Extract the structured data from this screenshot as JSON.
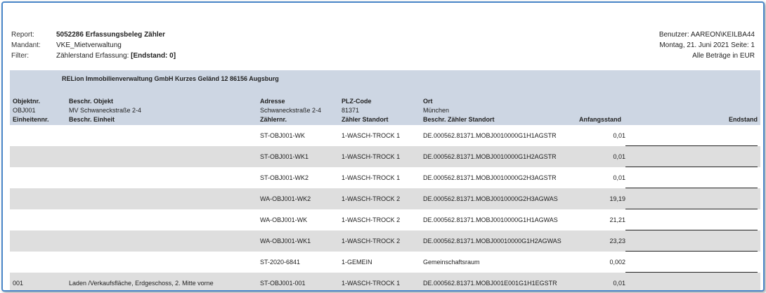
{
  "header": {
    "report_label": "Report:",
    "report_value": "5052286 Erfassungsbeleg Zähler",
    "mandant_label": "Mandant:",
    "mandant_value": "VKE_Mietverwaltung",
    "filter_label": "Filter:",
    "filter_prefix": "Zählerstand Erfassung: ",
    "filter_value": "[Endstand: 0]",
    "user": "Benutzer: AAREON\\KEILBA44",
    "date_page": "Montag, 21. Juni 2021 Seite: 1",
    "currency_note": "Alle Beträge in EUR"
  },
  "company": "RELion Immobilienverwaltung GmbH Kurzes Geländ 12 86156 Augsburg",
  "object_headers": {
    "objektnr": "Objektnr.",
    "beschr_objekt": "Beschr. Objekt",
    "adresse": "Adresse",
    "plz": "PLZ-Code",
    "ort": "Ort"
  },
  "object": {
    "objektnr": "OBJ001",
    "beschr_objekt": "MV Schwaneckstraße 2-4",
    "adresse": "Schwaneckstraße 2-4",
    "plz": "81371",
    "ort": "München"
  },
  "columns": {
    "einheitennr": "Einheitennr.",
    "beschr_einheit": "Beschr. Einheit",
    "zaehlernr": "Zählernr.",
    "zaehler_standort": "Zähler Standort",
    "beschr_zaehler_standort": "Beschr. Zähler Standort",
    "anfangsstand": "Anfangsstand",
    "endstand": "Endstand"
  },
  "rows": [
    {
      "einheit": "",
      "beschr": "",
      "zaehlernr": "ST-OBJ001-WK",
      "standort": "1-WASCH-TROCK 1",
      "beschr_standort": "DE.000562.81371.MOBJ0010000G1H1AGSTR",
      "anfang": "0,01"
    },
    {
      "einheit": "",
      "beschr": "",
      "zaehlernr": "ST-OBJ001-WK1",
      "standort": "1-WASCH-TROCK 1",
      "beschr_standort": "DE.000562.81371.MOBJ0010000G1H2AGSTR",
      "anfang": "0,01"
    },
    {
      "einheit": "",
      "beschr": "",
      "zaehlernr": "ST-OBJ001-WK2",
      "standort": "1-WASCH-TROCK 1",
      "beschr_standort": "DE.000562.81371.MOBJ0010000G2H3AGSTR",
      "anfang": "0,01"
    },
    {
      "einheit": "",
      "beschr": "",
      "zaehlernr": "WA-OBJ001-WK2",
      "standort": "1-WASCH-TROCK 2",
      "beschr_standort": "DE.000562.81371.MOBJ0010000G2H3AGWAS",
      "anfang": "19,19"
    },
    {
      "einheit": "",
      "beschr": "",
      "zaehlernr": "WA-OBJ001-WK",
      "standort": "1-WASCH-TROCK 2",
      "beschr_standort": "DE.000562.81371.MOBJ0010000G1H1AGWAS",
      "anfang": "21,21"
    },
    {
      "einheit": "",
      "beschr": "",
      "zaehlernr": "WA-OBJ001-WK1",
      "standort": "1-WASCH-TROCK 2",
      "beschr_standort": "DE.000562.81371.MOBJ00010000G1H2AGWAS",
      "anfang": "23,23"
    },
    {
      "einheit": "",
      "beschr": "",
      "zaehlernr": "ST-2020-6841",
      "standort": "1-GEMEIN",
      "beschr_standort": "Gemeinschaftsraum",
      "anfang": "0,002"
    },
    {
      "einheit": "001",
      "beschr": "Laden /Verkaufsfläche, Erdgeschoss, 2. Mitte vorne",
      "zaehlernr": "ST-OBJ001-001",
      "standort": "1-WASCH-TROCK 1",
      "beschr_standort": "DE.000562.81371.MOBJ001E001G1H1EGSTR",
      "anfang": "0,01"
    }
  ]
}
